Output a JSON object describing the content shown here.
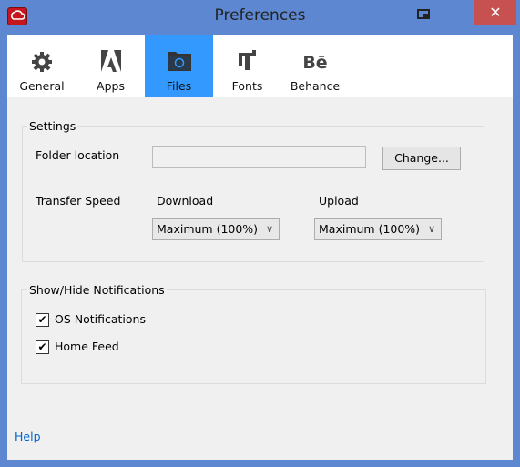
{
  "window": {
    "title": "Preferences",
    "close_glyph": "✕"
  },
  "tabs": [
    {
      "label": "General",
      "icon": "gear-icon"
    },
    {
      "label": "Apps",
      "icon": "adobe-icon"
    },
    {
      "label": "Files",
      "icon": "folder-cloud-icon",
      "active": true
    },
    {
      "label": "Fonts",
      "icon": "fonts-icon"
    },
    {
      "label": "Behance",
      "icon": "behance-icon",
      "glyph": "Bē"
    }
  ],
  "settings": {
    "legend": "Settings",
    "folder_label": "Folder location",
    "folder_value": "",
    "change_label": "Change...",
    "transfer_label": "Transfer Speed",
    "download_label": "Download",
    "upload_label": "Upload",
    "download_value": "Maximum (100%)",
    "upload_value": "Maximum (100%)",
    "chevron": "∨"
  },
  "notifications": {
    "legend": "Show/Hide Notifications",
    "items": [
      {
        "label": "OS Notifications",
        "checked": true
      },
      {
        "label": "Home Feed",
        "checked": true
      }
    ],
    "check": "✔"
  },
  "help_label": "Help",
  "colors": {
    "frame": "#5d87d0",
    "active_tab": "#3399ff",
    "close": "#c75050",
    "link": "#0066cc"
  }
}
